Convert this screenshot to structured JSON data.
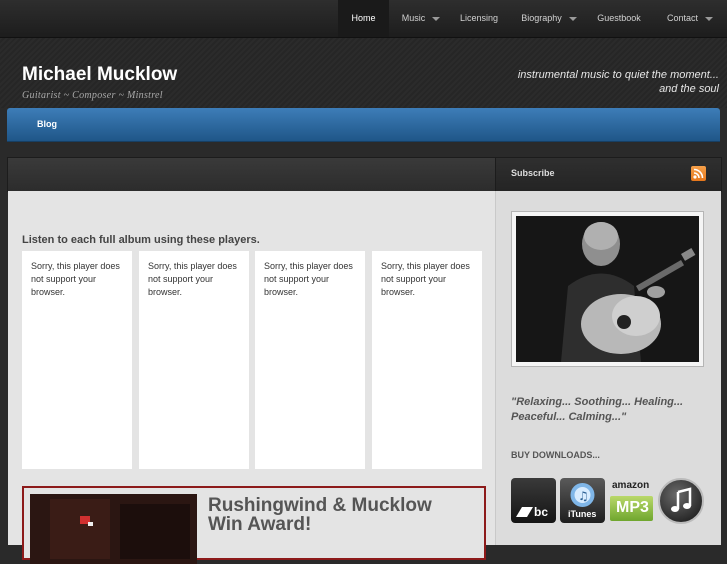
{
  "nav": {
    "items": [
      {
        "label": "Home",
        "active": true
      },
      {
        "label": "Music",
        "dropdown": true
      },
      {
        "label": "Licensing"
      },
      {
        "label": "Biography",
        "dropdown": true
      },
      {
        "label": "Guestbook"
      },
      {
        "label": "Contact",
        "dropdown": true
      }
    ]
  },
  "header": {
    "title": "Michael Mucklow",
    "tagline": "Guitarist ~ Composer ~ Minstrel",
    "quote_line1": "instrumental music to quiet the moment...",
    "quote_line2": "and the soul"
  },
  "subnav": {
    "blog": "Blog"
  },
  "main": {
    "listen_heading": "Listen to each full album using these players.",
    "players": [
      "Sorry, this player does not support your browser.",
      "Sorry, this player does not support your browser.",
      "Sorry, this player does not support your browser.",
      "Sorry, this player does not support your browser."
    ],
    "news_title_line1": "Rushingwind & Mucklow",
    "news_title_line2": "Win Award!"
  },
  "sidebar": {
    "subscribe_label": "Subscribe",
    "quote_line1": "\"Relaxing... Soothing... Healing...",
    "quote_line2": "Peaceful... Calming...\"",
    "buy_heading": "BUY DOWNLOADS...",
    "stores": {
      "bandcamp": "bc",
      "itunes": "iTunes",
      "amazon_top": "amazon",
      "amazon_bottom": "MP3"
    }
  },
  "colors": {
    "accent_blue": "#2a6aa3",
    "news_border": "#8d1a1a",
    "rss_orange": "#f08a2c"
  }
}
